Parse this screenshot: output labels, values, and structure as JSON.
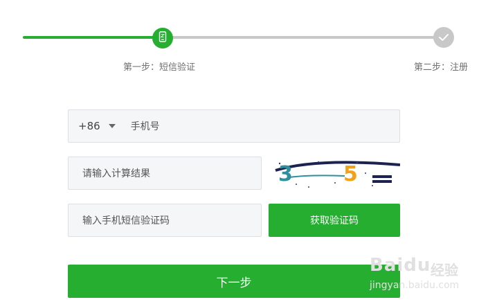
{
  "stepper": {
    "steps": [
      {
        "label": "第一步：短信验证",
        "state": "active",
        "icon": "phone-icon"
      },
      {
        "label": "第二步：注册",
        "state": "pending",
        "icon": "check-icon"
      }
    ],
    "active_color": "#25ae2f",
    "inactive_color": "#c8c8c8"
  },
  "form": {
    "phone": {
      "country_code": "+86",
      "placeholder": "手机号"
    },
    "captcha_input": {
      "placeholder": "请输入计算结果"
    },
    "captcha_image": {
      "glyphs": [
        "3",
        "5",
        "="
      ]
    },
    "sms_input": {
      "placeholder": "输入手机短信验证码"
    },
    "sms_button_label": "获取验证码",
    "next_button_label": "下一步"
  },
  "watermark": {
    "brand": "Baidu",
    "brand_cn": "经验",
    "url": "jingyan.baidu.com"
  },
  "colors": {
    "primary": "#25ae2f",
    "field_bg": "#f5f6f8",
    "field_border": "#dcdfe4"
  }
}
